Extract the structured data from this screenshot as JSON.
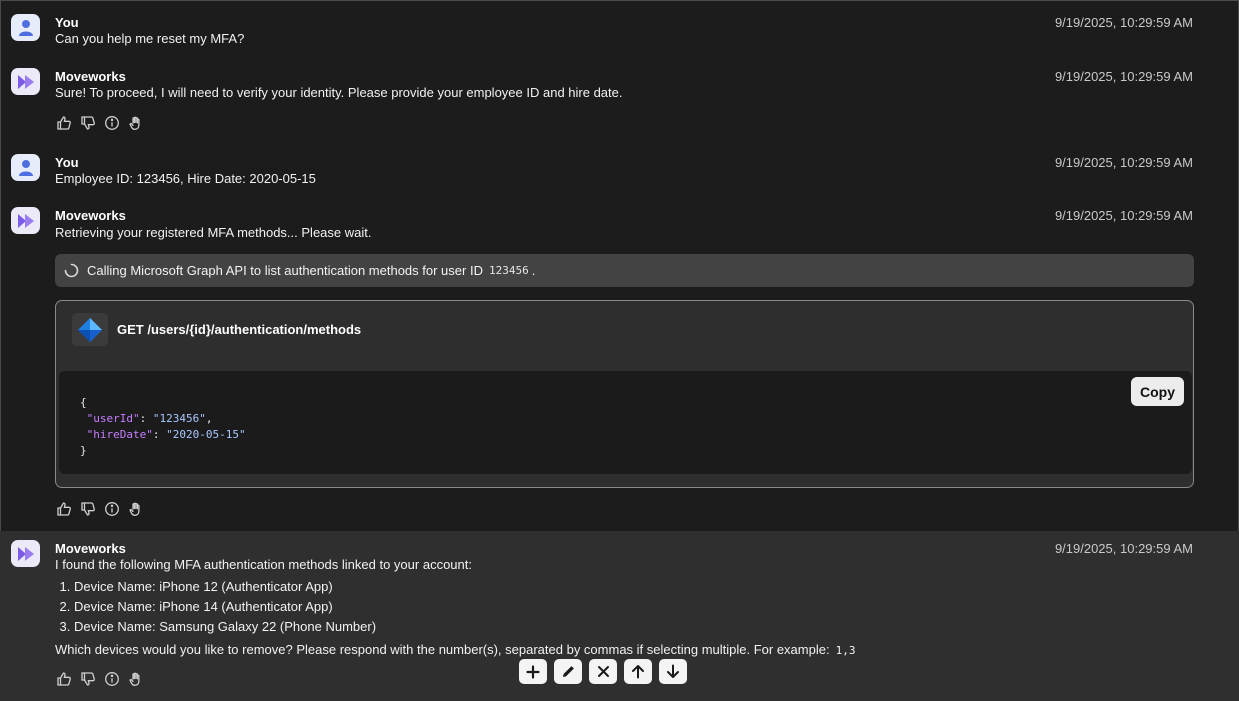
{
  "messages": [
    {
      "sender": "You",
      "text": "Can you help me reset my MFA?",
      "timestamp": "9/19/2025, 10:29:59 AM"
    },
    {
      "sender": "Moveworks",
      "text": "Sure! To proceed, I will need to verify your identity. Please provide your employee ID and hire date.",
      "timestamp": "9/19/2025, 10:29:59 AM"
    },
    {
      "sender": "You",
      "text": "Employee ID: 123456, Hire Date: 2020-05-15",
      "timestamp": "9/19/2025, 10:29:59 AM"
    },
    {
      "sender": "Moveworks",
      "text": "Retrieving your registered MFA methods... Please wait.",
      "timestamp": "9/19/2025, 10:29:59 AM"
    },
    {
      "sender": "Moveworks",
      "text": "I found the following MFA authentication methods linked to your account:",
      "timestamp": "9/19/2025, 10:29:59 AM"
    }
  ],
  "status": {
    "text": "Calling Microsoft Graph API to list authentication methods for user ID",
    "code": "123456",
    "suffix": "."
  },
  "api_call": {
    "title": "GET /users/{id}/authentication/methods",
    "copy_label": "Copy",
    "code": {
      "open": "{",
      "key1": "\"userId\"",
      "val1": "\"123456\"",
      "key2": "\"hireDate\"",
      "val2": "\"2020-05-15\"",
      "close": "}"
    }
  },
  "methods": [
    "Device Name: iPhone 12 (Authenticator App)",
    "Device Name: iPhone 14 (Authenticator App)",
    "Device Name: Samsung Galaxy 22 (Phone Number)"
  ],
  "question": {
    "text": "Which devices would you like to remove? Please respond with the number(s), separated by commas if selecting multiple. For example:",
    "example": "1,3"
  },
  "icons": {
    "user_avatar": "person-icon",
    "bot_avatar": "moveworks-logo-icon",
    "reactions": [
      "thumbs-up-icon",
      "thumbs-down-icon",
      "info-icon",
      "hand-icon"
    ],
    "toolbar": [
      "plus-icon",
      "pencil-icon",
      "close-icon",
      "arrow-up-icon",
      "arrow-down-icon"
    ]
  },
  "colors": {
    "background": "#1c1c1d",
    "highlight": "#2f2f30",
    "accent": "#6b5ce7",
    "json_key": "#c77dff",
    "json_string": "#a9c8ff"
  }
}
